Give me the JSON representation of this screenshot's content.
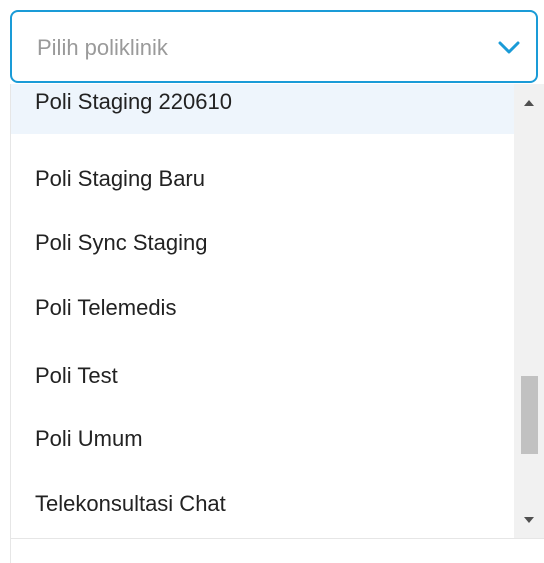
{
  "select": {
    "placeholder": "Pilih poliklinik",
    "icon": "chevron-down-icon",
    "accent_color": "#1a9bd7"
  },
  "options": [
    {
      "label": "Poli Staging 220610",
      "highlighted": true
    },
    {
      "label": "Poli Staging Baru",
      "highlighted": false
    },
    {
      "label": "Poli Sync Staging",
      "highlighted": false
    },
    {
      "label": "Poli Telemedis",
      "highlighted": false
    },
    {
      "label": "Poli Test",
      "highlighted": false
    },
    {
      "label": "Poli Umum",
      "highlighted": false
    },
    {
      "label": "Telekonsultasi Chat",
      "highlighted": false
    }
  ]
}
